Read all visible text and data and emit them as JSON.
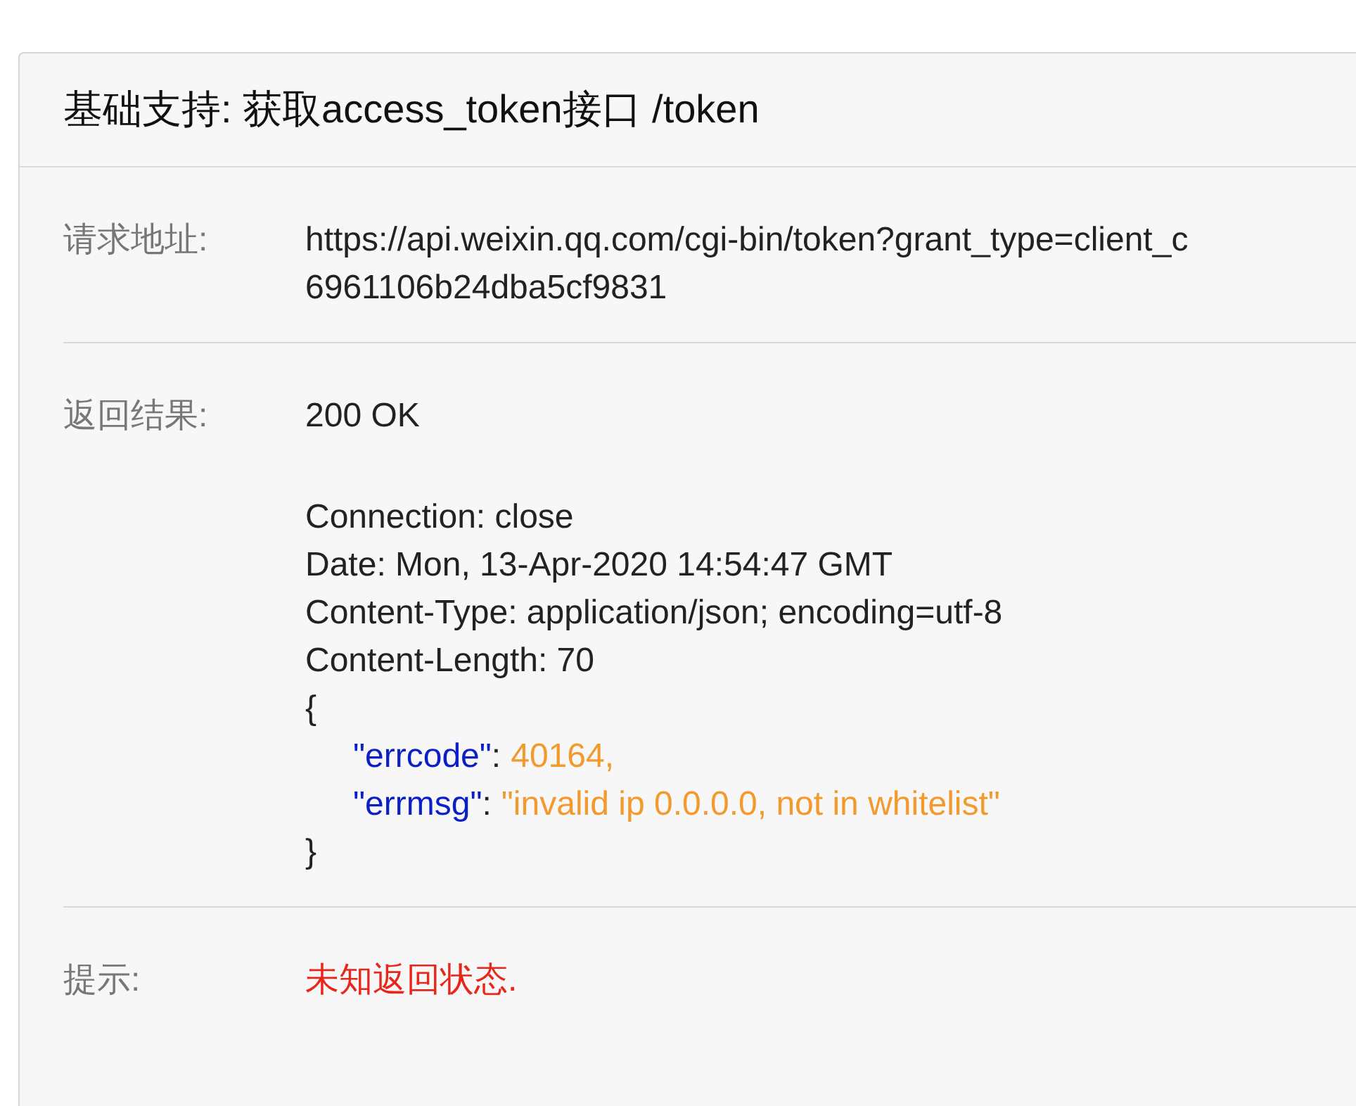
{
  "panel": {
    "title": "基础支持: 获取access_token接口 /token",
    "rows": [
      {
        "kind": "url",
        "label": "请求地址:",
        "lines": [
          "https://api.weixin.qq.com/cgi-bin/token?grant_type=client_c",
          "6961106b24dba5cf9831"
        ]
      },
      {
        "kind": "response",
        "label": "返回结果:",
        "status": "200 OK",
        "headers": [
          "Connection: close",
          "Date: Mon, 13-Apr-2020 14:54:47 GMT",
          "Content-Type: application/json; encoding=utf-8",
          "Content-Length: 70"
        ],
        "body": {
          "open": "{",
          "close": "}",
          "fields": [
            {
              "key": "\"errcode\"",
              "separator": ":",
              "value": "40164,"
            },
            {
              "key": "\"errmsg\"",
              "separator": ":",
              "value": "\"invalid ip 0.0.0.0, not in whitelist\""
            }
          ]
        }
      },
      {
        "kind": "hint",
        "label": "提示:",
        "text": "未知返回状态."
      }
    ]
  }
}
